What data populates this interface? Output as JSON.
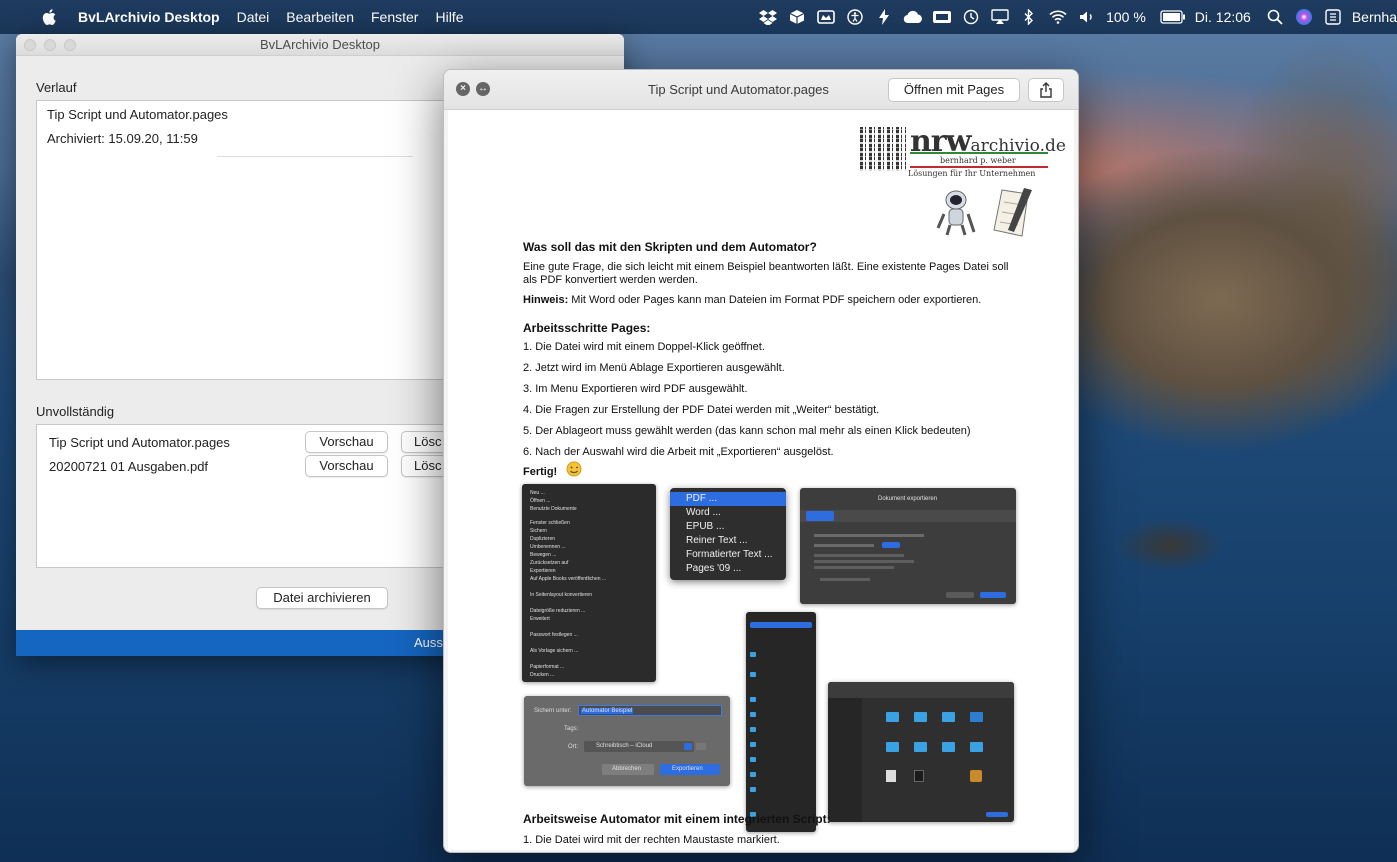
{
  "menubar": {
    "app_name": "BvLArchivio Desktop",
    "items": [
      "Datei",
      "Bearbeiten",
      "Fenster",
      "Hilfe"
    ],
    "battery": "100 %",
    "clock": "Di. 12:06",
    "user": "Bernha"
  },
  "main_window": {
    "title": "BvLArchivio Desktop",
    "verlauf_label": "Verlauf",
    "verlauf_lines": [
      "Tip Script und Automator.pages",
      "Archiviert: 15.09.20, 11:59"
    ],
    "unvollstaendig_label": "Unvollständig",
    "incomplete_rows": [
      {
        "name": "Tip Script und Automator.pages",
        "preview": "Vorschau",
        "delete": "Lösc"
      },
      {
        "name": "20200721 01 Ausgaben.pdf",
        "preview": "Vorschau",
        "delete": "Lösc"
      }
    ],
    "archive_button": "Datei archivieren",
    "status_text": "Auss"
  },
  "quicklook": {
    "title": "Tip Script und Automator.pages",
    "open_button": "Öffnen mit Pages",
    "logo": {
      "nrw": "nrw",
      "domain": "archivio.de",
      "name": "bernhard p. weber",
      "tagline": "Lösungen für Ihr Unternehmen"
    },
    "heading1": "Was soll das mit den Skripten und dem Automator?",
    "para1": "Eine gute Frage, die sich leicht mit einem Beispiel beantworten läßt. Eine existente Pages Datei soll als PDF konvertiert werden werden.",
    "hint_label": "Hinweis:",
    "hint_text": " Mit Word oder Pages kann man Dateien im Format PDF speichern oder exportieren.",
    "heading2": "Arbeitsschritte Pages:",
    "steps": [
      "1.  Die Datei wird mit einem Doppel-Klick geöffnet.",
      "2.  Jetzt wird im Menü Ablage Exportieren ausgewählt.",
      "3.  Im Menu Exportieren wird PDF ausgewählt.",
      "4.  Die Fragen zur Erstellung der PDF Datei werden mit „Weiter“ bestätigt.",
      "5.  Der Ablageort muss gewählt werden (das kann schon mal mehr als einen Klick bedeuten)",
      "6.  Nach der Auswahl wird die Arbeit mit „Exportieren“ ausgelöst."
    ],
    "fertig": "Fertig!",
    "export_menu": [
      "PDF ...",
      "Word ...",
      "EPUB ...",
      "Reiner Text ...",
      "Formatierter Text ...",
      "Pages '09 ..."
    ],
    "file_menu": [
      "Neu ...",
      "Öffnen ...",
      "Benutzte Dokumente",
      "Fenster schließen",
      "Sichern",
      "Duplizieren",
      "Umbenennen ...",
      "Bewegen ...",
      "Zurücksetzen auf",
      "Exportieren",
      "Auf Apple Books veröffentlichen ...",
      "In Seitenlayout konvertieren",
      "Dateigröße reduzieren ...",
      "Erweitert",
      "Passwort festlegen ...",
      "Als Vorlage sichern ...",
      "Papierformat ...",
      "Drucken ..."
    ],
    "export_dialog_title": "Dokument exportieren",
    "save_dialog": {
      "label_save": "Sichern unter:",
      "save_value": "Automator Beispiel",
      "label_tags": "Tags:",
      "label_where": "Ort:",
      "where_value": "Schreibtisch – iCloud",
      "cancel": "Abbrechen",
      "export": "Exportieren"
    },
    "heading3": "Arbeitsweise Automator mit einem integrierten Script:",
    "step_auto_1": "1.  Die Datei wird mit der rechten Maustaste markiert."
  }
}
